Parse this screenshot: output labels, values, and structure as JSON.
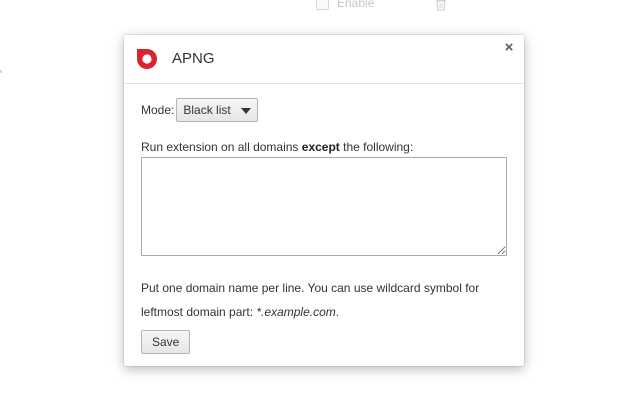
{
  "background": {
    "enable_label": "Enable"
  },
  "dialog": {
    "title": "APNG",
    "close_glyph": "×",
    "logo_color": "#d9232e",
    "mode": {
      "label": "Mode:",
      "selected": "Black list"
    },
    "instruction": {
      "prefix": "Run extension on all domains ",
      "emphasis": "except",
      "suffix": " the following:"
    },
    "domains": {
      "value": "",
      "placeholder": ""
    },
    "help": {
      "line1": "Put one domain name per line. You can use wildcard symbol for",
      "line2_prefix": "leftmost domain part: ",
      "example": "*.example.com",
      "line2_suffix": "."
    },
    "save_label": "Save"
  }
}
